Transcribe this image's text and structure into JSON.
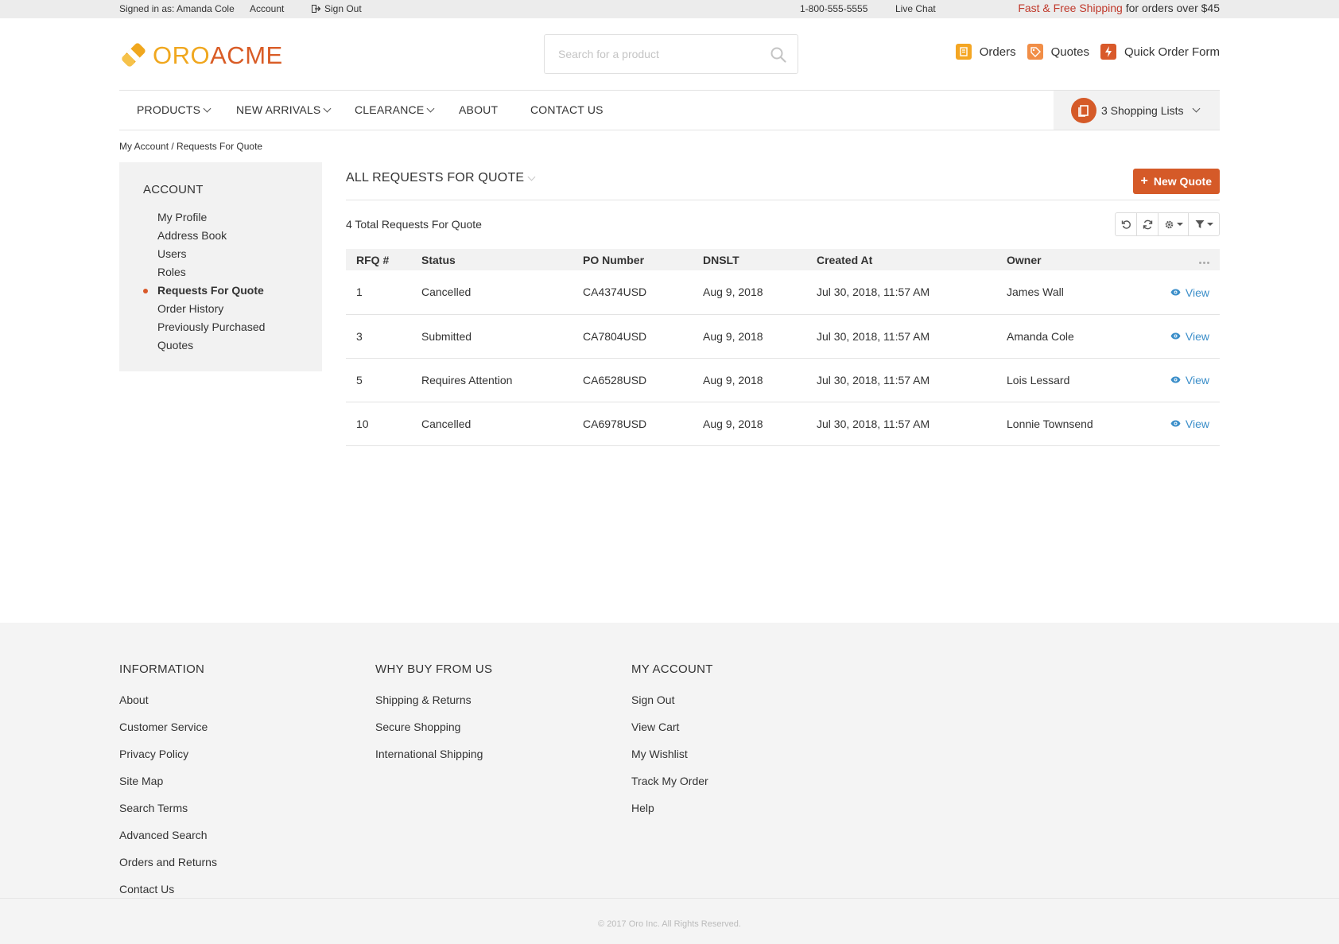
{
  "topbar": {
    "signed_in": "Signed in as: Amanda Cole",
    "account": "Account",
    "sign_out": "Sign Out",
    "phone": "1-800-555-5555",
    "live_chat": "Live Chat",
    "promo_accent": "Fast & Free Shipping",
    "promo_rest": " for orders over $45"
  },
  "header": {
    "logo_oro": "ORO",
    "logo_acme": "ACME",
    "search_placeholder": "Search for a product",
    "quicklinks": {
      "orders": "Orders",
      "quotes": "Quotes",
      "quick_order": "Quick Order Form"
    }
  },
  "nav": {
    "items": [
      "PRODUCTS",
      "NEW ARRIVALS",
      "CLEARANCE",
      "ABOUT",
      "CONTACT US"
    ],
    "shopping_lists": "3 Shopping Lists"
  },
  "breadcrumb": "My Account / Requests For Quote",
  "sidebar": {
    "title": "ACCOUNT",
    "items": [
      "My Profile",
      "Address Book",
      "Users",
      "Roles",
      "Requests For Quote",
      "Order History",
      "Previously Purchased",
      "Quotes"
    ],
    "active": "Requests For Quote"
  },
  "content": {
    "title": "ALL REQUESTS FOR QUOTE",
    "new_quote": "New Quote",
    "total": "4 Total Requests For Quote",
    "columns": [
      "RFQ #",
      "Status",
      "PO Number",
      "DNSLT",
      "Created At",
      "Owner"
    ],
    "rows": [
      {
        "rfq": "1",
        "status": "Cancelled",
        "po": "CA4374USD",
        "dnslt": "Aug 9, 2018",
        "created": "Jul 30, 2018, 11:57 AM",
        "owner": "James Wall",
        "action": "View"
      },
      {
        "rfq": "3",
        "status": "Submitted",
        "po": "CA7804USD",
        "dnslt": "Aug 9, 2018",
        "created": "Jul 30, 2018, 11:57 AM",
        "owner": "Amanda Cole",
        "action": "View"
      },
      {
        "rfq": "5",
        "status": "Requires Attention",
        "po": "CA6528USD",
        "dnslt": "Aug 9, 2018",
        "created": "Jul 30, 2018, 11:57 AM",
        "owner": "Lois Lessard",
        "action": "View"
      },
      {
        "rfq": "10",
        "status": "Cancelled",
        "po": "CA6978USD",
        "dnslt": "Aug 9, 2018",
        "created": "Jul 30, 2018, 11:57 AM",
        "owner": "Lonnie Townsend",
        "action": "View"
      }
    ]
  },
  "footer": {
    "columns": [
      {
        "title": "INFORMATION",
        "links": [
          "About",
          "Customer Service",
          "Privacy Policy",
          "Site Map",
          "Search Terms",
          "Advanced Search",
          "Orders and Returns",
          "Contact Us"
        ]
      },
      {
        "title": "WHY BUY FROM US",
        "links": [
          "Shipping & Returns",
          "Secure Shopping",
          "International Shipping"
        ]
      },
      {
        "title": "MY ACCOUNT",
        "links": [
          "Sign Out",
          "View Cart",
          "My Wishlist",
          "Track My Order",
          "Help"
        ]
      }
    ],
    "copyright": "© 2017 Oro Inc. All Rights Reserved."
  },
  "colors": {
    "brand_orange": "#d55a28",
    "brand_yellow": "#f0a71e",
    "link_blue": "#3b8ec9",
    "promo_red": "#c0392b"
  },
  "icons": {
    "sign_out": "sign-out-icon",
    "search": "search-icon",
    "orders": "orders-icon",
    "quotes": "tag-icon",
    "quick_order": "lightning-icon",
    "shopping_list": "shopping-list-icon",
    "reset": "reset-icon",
    "refresh": "refresh-icon",
    "settings": "gear-icon",
    "filter": "filter-icon",
    "view": "eye-icon"
  }
}
